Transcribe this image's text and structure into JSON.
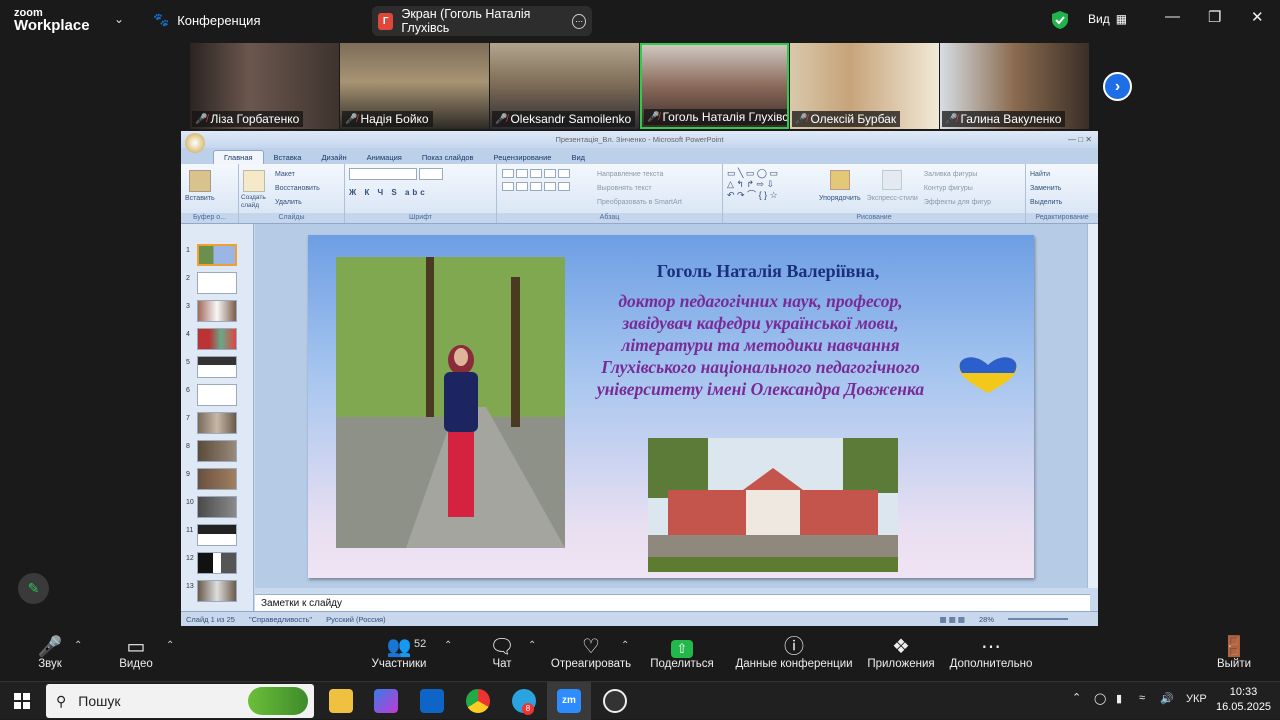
{
  "app": {
    "brand_line1": "zoom",
    "brand_line2": "Workplace",
    "conference_label": "Конференция",
    "view_label": "Вид"
  },
  "share": {
    "initial": "Г",
    "label": "Экран (Гоголь Наталія Глухівсь"
  },
  "participants": [
    {
      "name": "Ліза Горбатенко",
      "bg": "#5a4b45"
    },
    {
      "name": "Надія Бойко",
      "bg": "#6b5a48"
    },
    {
      "name": "Oleksandr Samoilenko",
      "bg": "#8a7a62"
    },
    {
      "name": "Гоголь Наталія Глухівсь...",
      "bg": "#a89f95",
      "active": true
    },
    {
      "name": "Олексій Бурбак",
      "bg": "#b9a787"
    },
    {
      "name": "Галина Вакуленко",
      "bg": "#6e5c4b"
    }
  ],
  "ppt": {
    "window_title": "Презентація_Вл. Зінченко - Microsoft PowerPoint",
    "tabs": [
      "Главная",
      "Вставка",
      "Дизайн",
      "Анимация",
      "Показ слайдов",
      "Рецензирование",
      "Вид"
    ],
    "ribbon": {
      "paste": "Вставить",
      "clipboard_group": "Буфер о...",
      "create_slide": "Создать слайд",
      "layout": "Макет",
      "restore": "Восстановить",
      "delete": "Удалить",
      "slides_group": "Слайды",
      "font_group": "Шрифт",
      "text_direction": "Направление текста",
      "align_text": "Выровнять текст",
      "smartart": "Преобразовать в SmartArt",
      "paragraph_group": "Абзац",
      "arrange": "Упорядочить",
      "quick_styles": "Экспресс-стили",
      "shape_fill": "Заливка фигуры",
      "shape_outline": "Контур фигуры",
      "shape_effects": "Эффекты для фигур",
      "drawing_group": "Рисование",
      "find": "Найти",
      "replace": "Заменить",
      "select": "Выделить",
      "editing_group": "Редактирование"
    },
    "thumb_numbers": [
      "1",
      "2",
      "3",
      "4",
      "5",
      "6",
      "7",
      "8",
      "9",
      "10",
      "11",
      "12",
      "13"
    ],
    "slide": {
      "title": "Гоголь Наталія Валеріївна,",
      "subtitle": "доктор педагогічних наук, професор, завідувач кафедри української мови, літератури та методики навчання Глухівського національного педагогічного університету імені Олександра Довженка"
    },
    "notes": "Заметки к слайду",
    "status": {
      "slide": "Слайд 1 из 25",
      "theme": "\"Справедливость\"",
      "lang": "Русский (Россия)",
      "zoom": "28%"
    }
  },
  "toolbar": {
    "audio": "Звук",
    "video": "Видео",
    "participants": "Участники",
    "participants_count": "52",
    "chat": "Чат",
    "react": "Отреагировать",
    "share": "Поделиться",
    "info": "Данные конференции",
    "apps": "Приложения",
    "more": "Дополнительно",
    "leave": "Выйти"
  },
  "taskbar": {
    "search": "Пошук",
    "lang": "УКР",
    "time": "10:33",
    "date": "16.05.2025",
    "telegram_badge": "8"
  }
}
